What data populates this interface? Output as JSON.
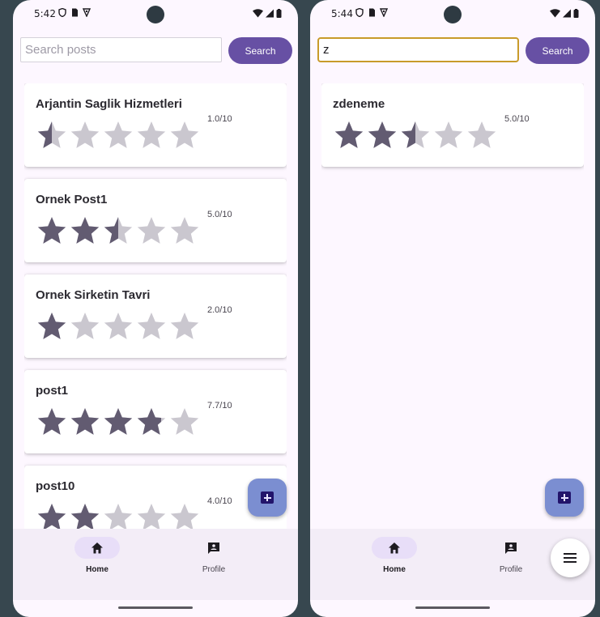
{
  "colors": {
    "star_filled": "#625b71",
    "star_empty": "#cac7cf",
    "accent": "#6750a4"
  },
  "screens": [
    {
      "status": {
        "time": "5:42"
      },
      "search": {
        "value": "",
        "placeholder": "Search posts",
        "button_label": "Search"
      },
      "posts": [
        {
          "title": "Arjantin Saglik Hizmetleri",
          "score": "1.0/10",
          "rating": 1.0
        },
        {
          "title": "Ornek Post1",
          "score": "5.0/10",
          "rating": 5.0
        },
        {
          "title": "Ornek Sirketin Tavri",
          "score": "2.0/10",
          "rating": 2.0
        },
        {
          "title": "post1",
          "score": "7.7/10",
          "rating": 7.7
        },
        {
          "title": "post10",
          "score": "4.0/10",
          "rating": 4.0
        }
      ],
      "nav": [
        {
          "label": "Home",
          "icon": "home-icon"
        },
        {
          "label": "Profile",
          "icon": "profile-icon"
        }
      ]
    },
    {
      "status": {
        "time": "5:44"
      },
      "search": {
        "value": "z",
        "placeholder": "Search posts",
        "button_label": "Search"
      },
      "posts": [
        {
          "title": "zdeneme",
          "score": "5.0/10",
          "rating": 5.0
        }
      ],
      "nav": [
        {
          "label": "Home",
          "icon": "home-icon"
        },
        {
          "label": "Profile",
          "icon": "profile-icon"
        }
      ]
    }
  ]
}
